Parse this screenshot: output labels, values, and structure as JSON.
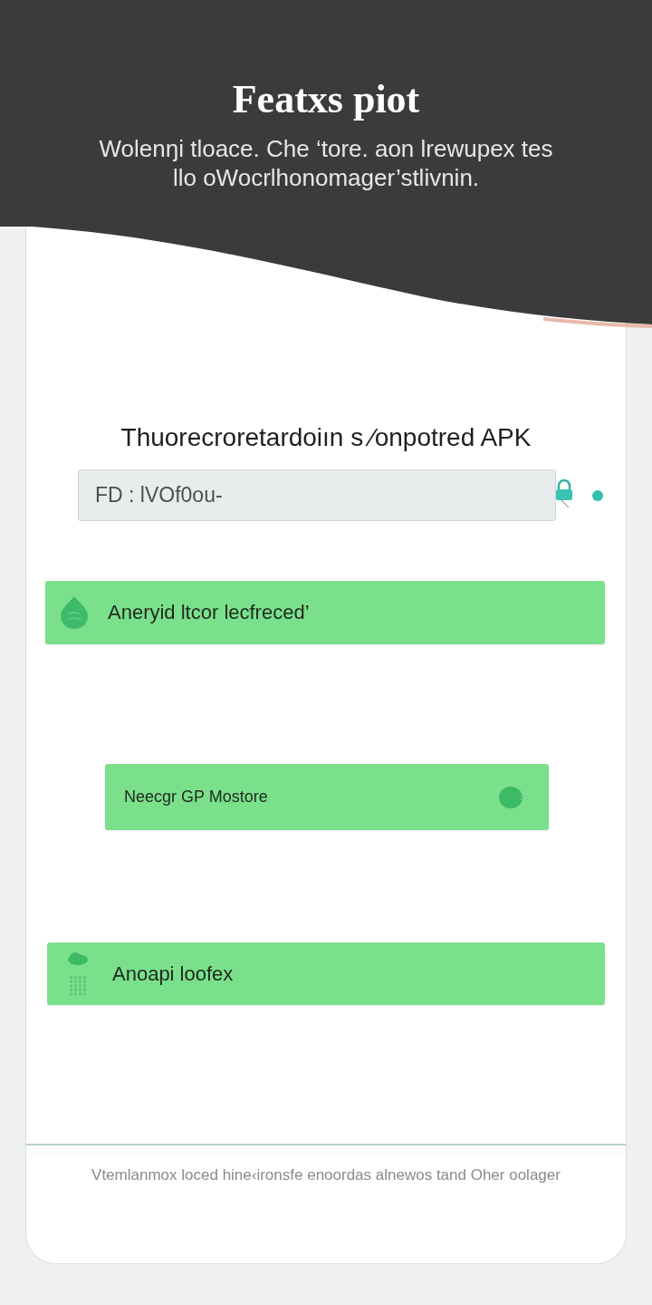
{
  "header": {
    "title": "Featxs piot",
    "subtitle": "Wolenŋi tloace. Che ‘tore. aon lrewupex tes llo oWocrlhonomager’stlivnin."
  },
  "card": {
    "heading": "Thuorecroretardoiın s ⁄onpotred APK",
    "input": {
      "value": "FD : lVOf0ou-"
    },
    "actions": [
      {
        "kind": "leading",
        "label": "Aneryid ltcor lecfreced’"
      },
      {
        "kind": "trailing",
        "label": "Neecgr GP Mostore"
      },
      {
        "kind": "stacked",
        "label": "Anoapi loofex"
      }
    ]
  },
  "footer": {
    "text": "Vtemlanmox loced hine‹ironsfe enoordas alnewos tand Oher oolager"
  }
}
